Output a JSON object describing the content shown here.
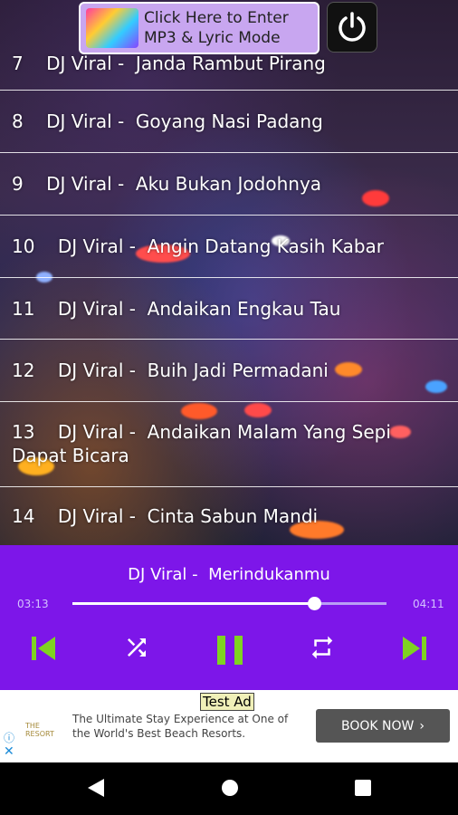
{
  "top_ad": {
    "line1": "Click Here to Enter",
    "line2": "MP3 & Lyric Mode"
  },
  "songs": [
    {
      "text": "7    DJ Viral -  Janda Rambut Pirang"
    },
    {
      "text": "8    DJ Viral -  Goyang Nasi Padang"
    },
    {
      "text": "9    DJ Viral -  Aku Bukan Jodohnya"
    },
    {
      "text": "10    DJ Viral -  Angin Datang Kasih Kabar"
    },
    {
      "text": "11    DJ Viral -  Andaikan Engkau Tau"
    },
    {
      "text": "12    DJ Viral -  Buih Jadi Permadani"
    },
    {
      "text": "13    DJ Viral -  Andaikan Malam Yang Sepi Dapat Bicara"
    },
    {
      "text": "14    DJ Viral -  Cinta Sabun Mandi"
    }
  ],
  "player": {
    "title": "DJ Viral -  Merindukanmu",
    "elapsed": "03:13",
    "total": "04:11",
    "progress": 0.77
  },
  "bottom_ad": {
    "label": "Test Ad",
    "text": "The Ultimate Stay Experience at One of the World's Best Beach Resorts.",
    "button": "BOOK NOW",
    "logo_text": "THE RESORT"
  },
  "colors": {
    "player_bg": "#7d16e9",
    "control_green": "#7fd321"
  },
  "icons": [
    "power-icon",
    "skip-previous-icon",
    "shuffle-icon",
    "pause-icon",
    "repeat-icon",
    "skip-next-icon",
    "back-nav-icon",
    "home-nav-icon",
    "recents-nav-icon",
    "ad-info-icon",
    "ad-close-icon",
    "chevron-right-icon"
  ]
}
